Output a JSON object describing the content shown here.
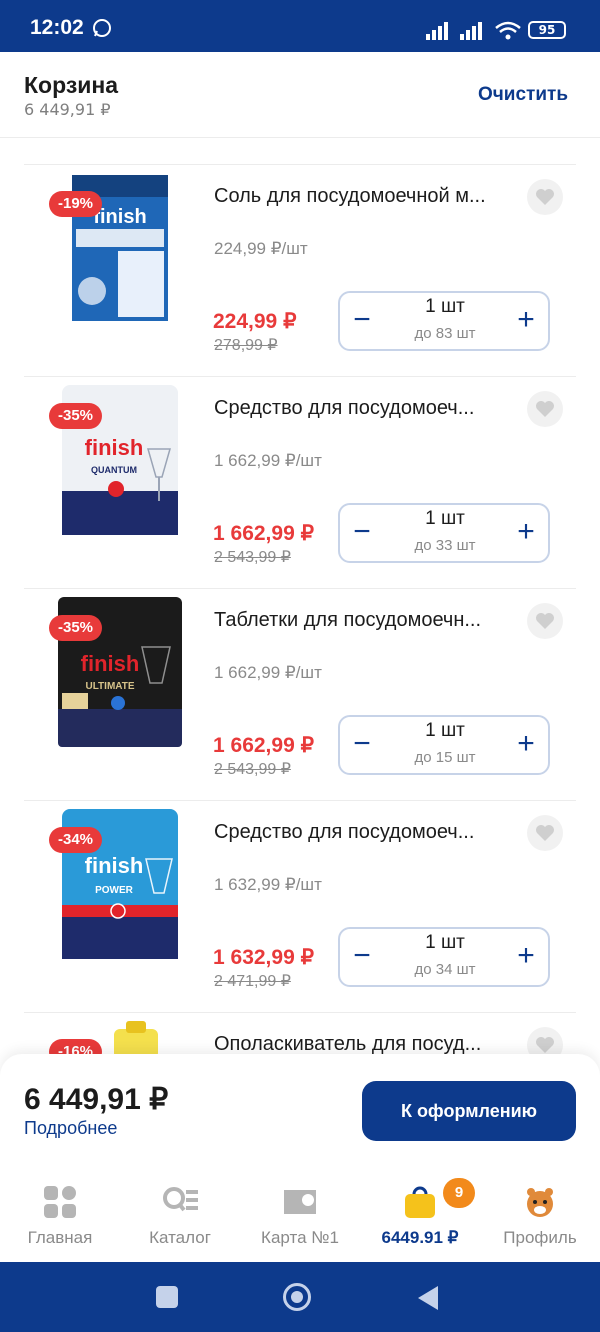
{
  "status_bar": {
    "time": "12:02",
    "battery": "95"
  },
  "header": {
    "title": "Корзина",
    "subtitle": "6 449,91 ₽",
    "clear": "Очистить"
  },
  "products": [
    {
      "discount": "-19%",
      "name": "Соль для посудомоечной м...",
      "unit_price": "224,99 ₽/шт",
      "price": "224,99 ₽",
      "old_price": "278,99 ₽",
      "qty": "1 шт",
      "limit": "до 83 шт",
      "pack": "salt"
    },
    {
      "discount": "-35%",
      "name": "Средство для посудомоеч...",
      "unit_price": "1 662,99 ₽/шт",
      "price": "1 662,99 ₽",
      "old_price": "2 543,99 ₽",
      "qty": "1 шт",
      "limit": "до 33 шт",
      "pack": "quantum"
    },
    {
      "discount": "-35%",
      "name": "Таблетки для посудомоечн...",
      "unit_price": "1 662,99 ₽/шт",
      "price": "1 662,99 ₽",
      "old_price": "2 543,99 ₽",
      "qty": "1 шт",
      "limit": "до 15 шт",
      "pack": "ultimate"
    },
    {
      "discount": "-34%",
      "name": "Средство для посудомоеч...",
      "unit_price": "1 632,99 ₽/шт",
      "price": "1 632,99 ₽",
      "old_price": "2 471,99 ₽",
      "qty": "1 шт",
      "limit": "до 34 шт",
      "pack": "power"
    },
    {
      "discount": "-16%",
      "name": "Ополаскиватель для посуд...",
      "pack": "rinse"
    }
  ],
  "checkout": {
    "total": "6 449,91 ₽",
    "details": "Подробнее",
    "button": "К оформлению"
  },
  "nav": [
    {
      "label": "Главная"
    },
    {
      "label": "Каталог"
    },
    {
      "label": "Карта №1"
    },
    {
      "label": "6449.91 ₽"
    },
    {
      "label": "Профиль"
    }
  ],
  "cart_badge": "9",
  "colors": {
    "brand": "#0d3a8c",
    "sale": "#e83a3a",
    "badge": "#f28a1b"
  }
}
